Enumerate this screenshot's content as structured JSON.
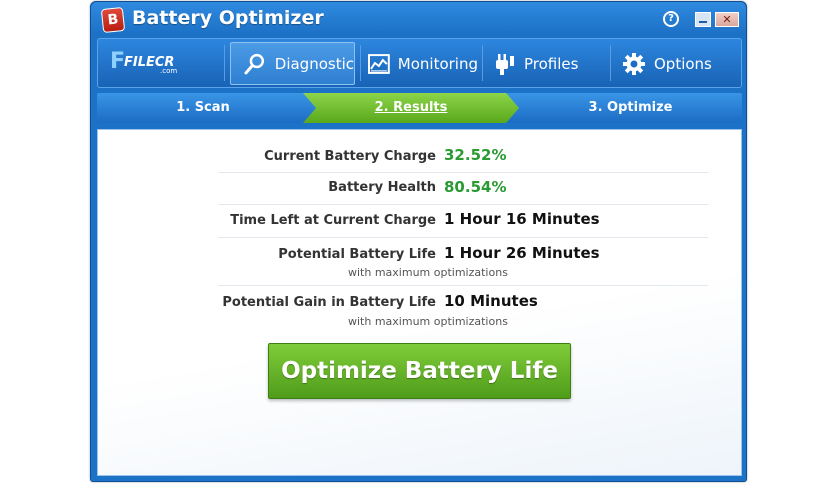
{
  "window": {
    "title": "Battery Optimizer",
    "logo_letter": "B",
    "help_symbol": "?",
    "close_symbol": "✕"
  },
  "nav": {
    "watermark": {
      "letter": "F",
      "text": "FILECR",
      "sub": ".com"
    },
    "items": [
      {
        "label": "Diagnostic",
        "icon": "magnifier-icon",
        "active": true
      },
      {
        "label": "Monitoring",
        "icon": "chart-icon",
        "active": false
      },
      {
        "label": "Profiles",
        "icon": "plug-icon",
        "active": false
      },
      {
        "label": "Options",
        "icon": "gear-icon",
        "active": false
      }
    ]
  },
  "steps": [
    {
      "label": "1. Scan",
      "active": false
    },
    {
      "label": "2. Results",
      "active": true
    },
    {
      "label": "3. Optimize",
      "active": false
    }
  ],
  "results": [
    {
      "label": "Current Battery Charge",
      "value": "32.52%",
      "value_color": "#2a9a32"
    },
    {
      "label": "Battery Health",
      "value": "80.54%",
      "value_color": "#2a9a32"
    },
    {
      "label": "Time Left at Current Charge",
      "value": "1 Hour 16 Minutes"
    },
    {
      "label": "Potential Battery Life",
      "value": "1 Hour 26 Minutes",
      "note": "with maximum optimizations"
    },
    {
      "label": "Potential Gain in Battery Life",
      "value": "10 Minutes",
      "note": "with maximum optimizations"
    }
  ],
  "optimize_button": {
    "label": "Optimize Battery Life"
  },
  "colors": {
    "accent_blue": "#1c72c6",
    "success_green": "#2a9a32",
    "button_green": "#5aa81c"
  }
}
